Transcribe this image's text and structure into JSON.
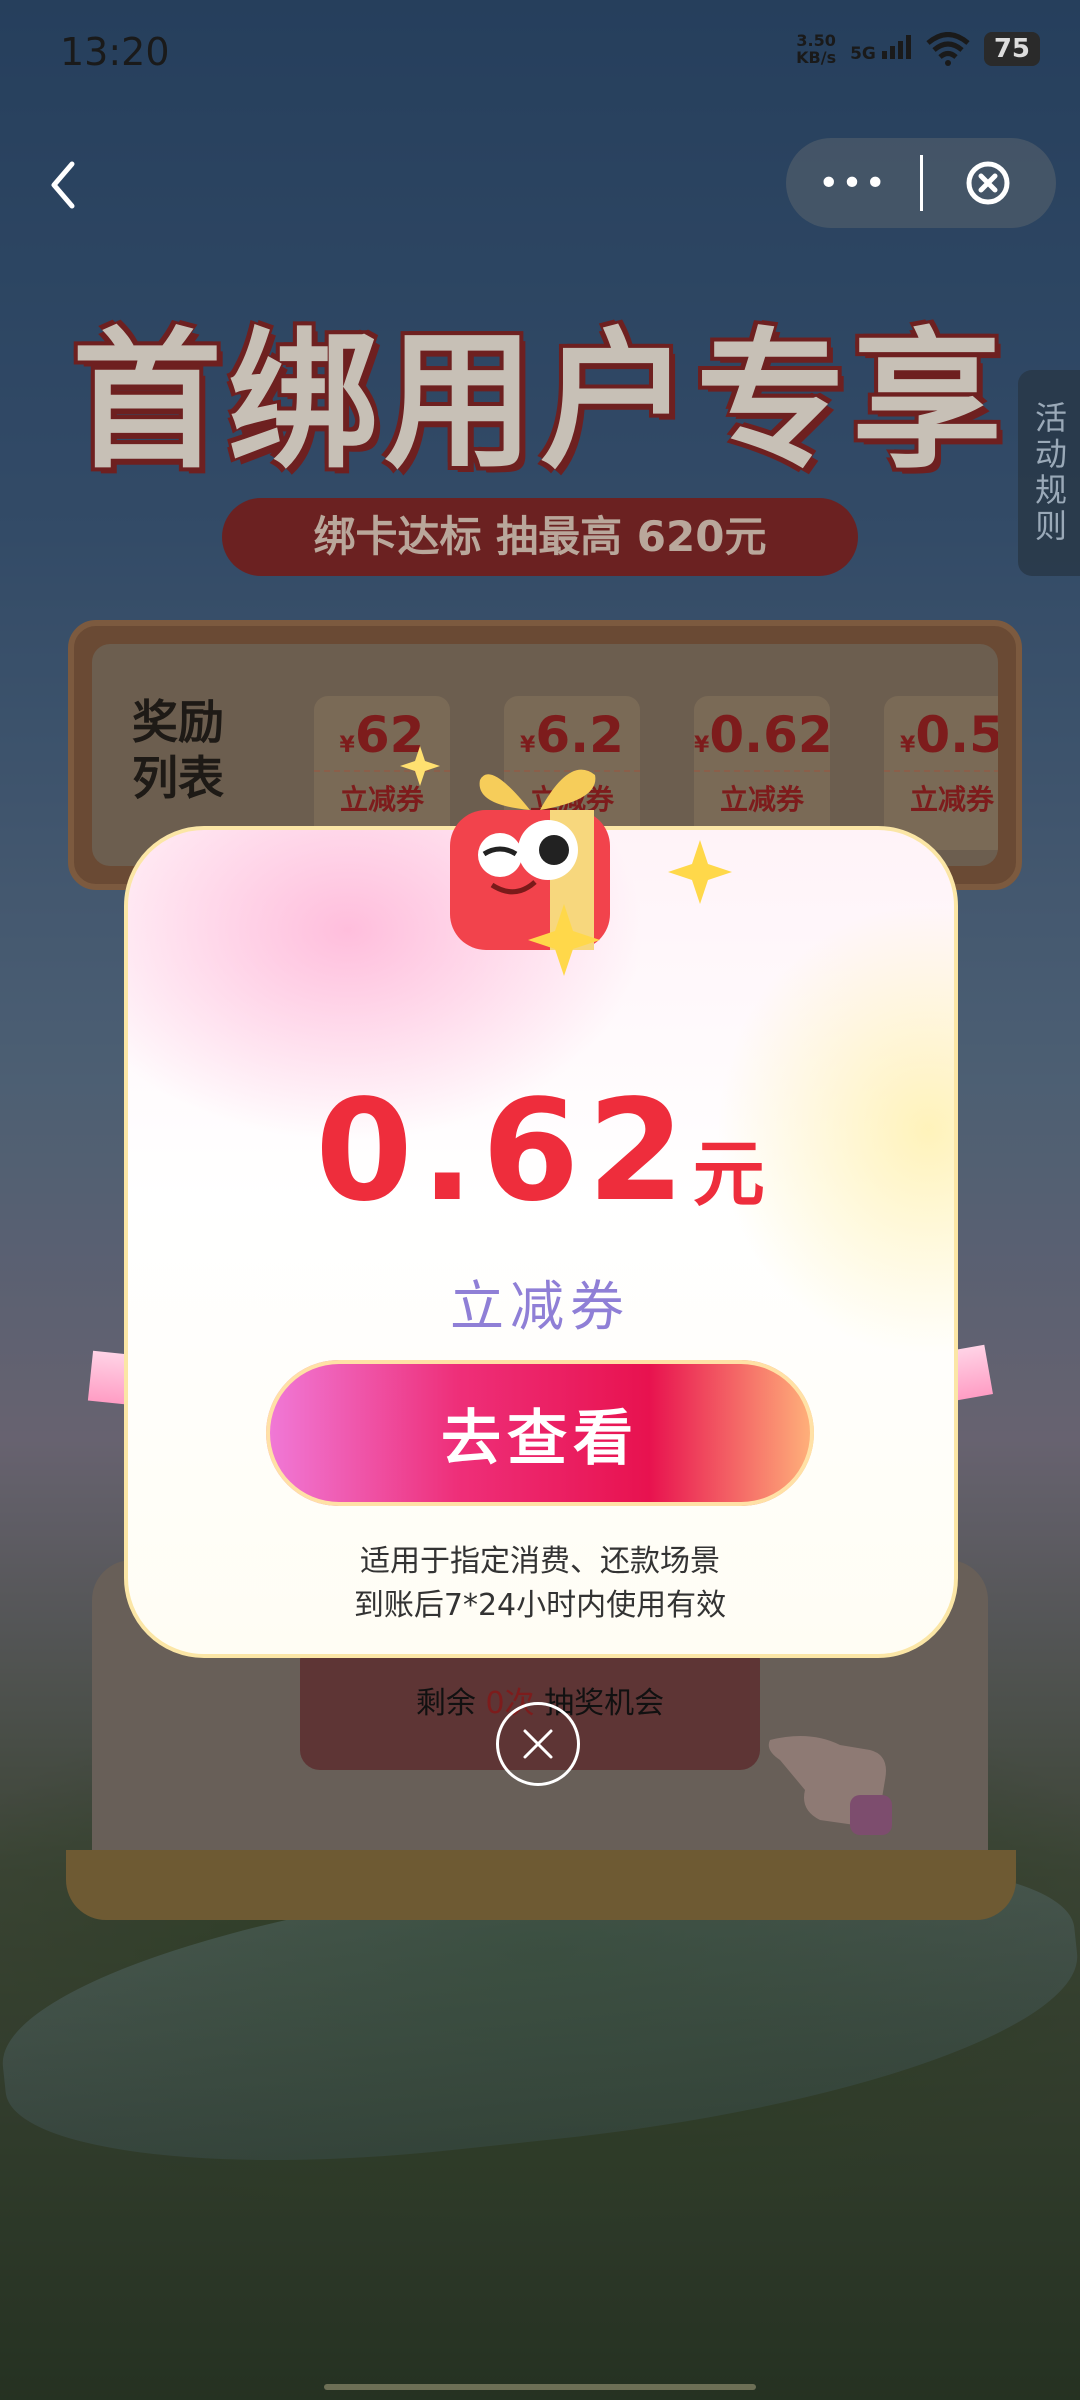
{
  "status_bar": {
    "time": "13:20",
    "net_speed_top": "3.50",
    "net_speed_unit": "KB/s",
    "network": "5G",
    "battery": "75"
  },
  "nav": {
    "more_label": "•••"
  },
  "banner": {
    "title": "首绑用户专享",
    "subtitle": "绑卡达标 抽最高 620元",
    "rules": "活动规则"
  },
  "reward_list": {
    "heading_line1": "奖励",
    "heading_line2": "列表",
    "currency": "¥",
    "coupons": [
      {
        "amount": "62",
        "label": "立减券"
      },
      {
        "amount": "6.2",
        "label": "立减券"
      },
      {
        "amount": "0.62",
        "label": "立减券"
      },
      {
        "amount": "0.5",
        "label": "立减券"
      }
    ]
  },
  "draw": {
    "remain_prefix": "剩余",
    "remain_count": "0次",
    "remain_suffix": "抽奖机会"
  },
  "popup": {
    "amount": "0.62",
    "unit": "元",
    "type": "立减券",
    "button": "去查看",
    "note_line1": "适用于指定消费、还款场景",
    "note_line2": "到账后7*24小时内使用有效"
  },
  "colors": {
    "accent": "#ee2d3c",
    "coupon_type": "#8f7fd6",
    "button_pink": "#e8124f"
  }
}
